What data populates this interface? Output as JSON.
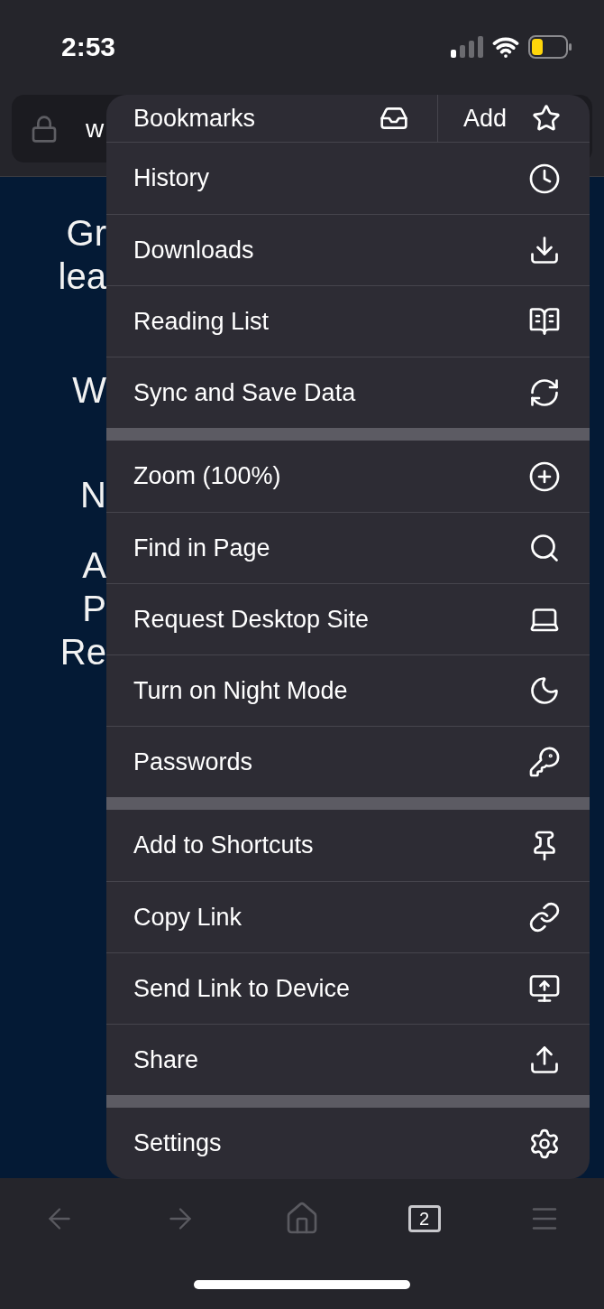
{
  "status_bar": {
    "time": "2:53"
  },
  "address_bar": {
    "url": "w"
  },
  "page": {
    "lines": [
      "Gr",
      "lea",
      "W",
      "N",
      "A",
      "P",
      "Re"
    ]
  },
  "menu": {
    "top_row": [
      {
        "label": "Bookmarks"
      },
      {
        "label": "Add"
      }
    ],
    "sections": [
      [
        {
          "label": "History"
        },
        {
          "label": "Downloads"
        },
        {
          "label": "Reading List"
        },
        {
          "label": "Sync and Save Data"
        }
      ],
      [
        {
          "label": "Zoom (100%)"
        },
        {
          "label": "Find in Page"
        },
        {
          "label": "Request Desktop Site"
        },
        {
          "label": "Turn on Night Mode"
        },
        {
          "label": "Passwords"
        }
      ],
      [
        {
          "label": "Add to Shortcuts"
        },
        {
          "label": "Copy Link"
        },
        {
          "label": "Send Link to Device"
        },
        {
          "label": "Share"
        }
      ],
      [
        {
          "label": "Settings"
        }
      ]
    ]
  },
  "toolbar": {
    "tab_count": "2"
  }
}
